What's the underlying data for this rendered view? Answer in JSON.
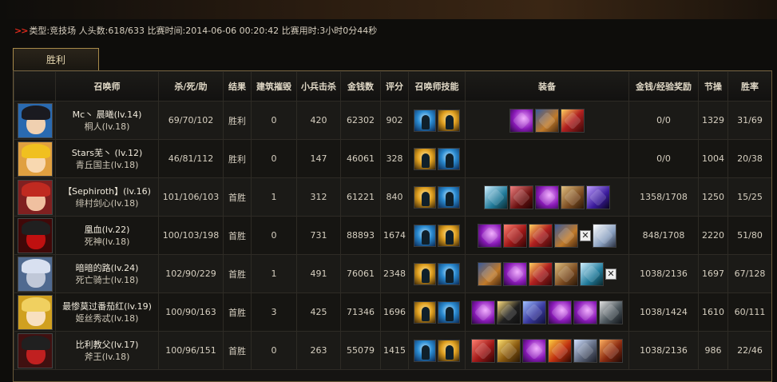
{
  "match_info": {
    "arrows": ">>",
    "text": "类型:竞技场 人头数:618/633 比赛时间:2014-06-06 00:20:42 比赛用时:3小时0分44秒"
  },
  "tab": {
    "label": "胜利"
  },
  "table": {
    "headers": {
      "avatar": "",
      "summoner": "召唤师",
      "kda": "杀/死/助",
      "result": "结果",
      "buildings": "建筑摧毁",
      "cs": "小兵击杀",
      "gold": "金钱数",
      "score": "评分",
      "skills": "召唤师技能",
      "items": "装备",
      "reward": "金钱/经验奖励",
      "integrity": "节操",
      "winrate": "胜率"
    },
    "rows": [
      {
        "avatar_icon": "kirito-avatar-icon",
        "name": "Mc丶 晨曦(lv.14)",
        "hero": "桐人(lv.18)",
        "kda": "69/70/102",
        "result": "胜利",
        "buildings": "0",
        "cs": "420",
        "gold": "62302",
        "score": "902",
        "skills": [
          "flash-icon",
          "teleport-icon"
        ],
        "items": [
          "purple-orb-item-icon",
          "armor-item-icon",
          "spear-item-icon"
        ],
        "reward": "0/0",
        "integrity": "1329",
        "winrate": "31/69"
      },
      {
        "avatar_icon": "naruto-avatar-icon",
        "name": "Stars芜丶 (lv.12)",
        "hero": "青丘国主(lv.18)",
        "kda": "46/81/112",
        "result": "胜利",
        "buildings": "0",
        "cs": "147",
        "gold": "46061",
        "score": "328",
        "skills": [
          "teleport-icon",
          "flash-icon"
        ],
        "items": [],
        "reward": "0/0",
        "integrity": "1004",
        "winrate": "20/38"
      },
      {
        "avatar_icon": "kenshin-avatar-icon",
        "name": "【Sephiroth】(lv.16)",
        "hero": "绯村剑心(lv.18)",
        "kda": "101/106/103",
        "result": "首胜",
        "buildings": "1",
        "cs": "312",
        "gold": "61221",
        "score": "840",
        "skills": [
          "teleport-icon",
          "flash-icon"
        ],
        "items": [
          "wolf-item-icon",
          "mask-item-icon",
          "purple-orb-item-icon",
          "axe-item-icon",
          "blade-item-icon"
        ],
        "reward": "1358/1708",
        "integrity": "1250",
        "winrate": "15/25"
      },
      {
        "avatar_icon": "reaper-avatar-icon",
        "name": "凰血(lv.22)",
        "hero": "死神(lv.18)",
        "kda": "100/103/198",
        "result": "首胜",
        "buildings": "0",
        "cs": "731",
        "gold": "88893",
        "score": "1674",
        "skills": [
          "flash-icon",
          "teleport-icon"
        ],
        "items": [
          "purple-orb-item-icon",
          "red-claw-item-icon",
          "spear-item-icon",
          "armor-item-icon",
          "empty-slot-icon",
          "wing-item-icon"
        ],
        "reward": "848/1708",
        "integrity": "2220",
        "winrate": "51/80"
      },
      {
        "avatar_icon": "death-knight-avatar-icon",
        "name": "暗暗的路(lv.24)",
        "hero": "死亡骑士(lv.18)",
        "kda": "102/90/229",
        "result": "首胜",
        "buildings": "1",
        "cs": "491",
        "gold": "76061",
        "score": "2348",
        "skills": [
          "teleport-icon",
          "flash-icon"
        ],
        "items": [
          "armor-item-icon",
          "purple-orb-item-icon",
          "spear-item-icon",
          "axe-item-icon",
          "wolf-item-icon",
          "empty-slot-icon"
        ],
        "reward": "1038/2136",
        "integrity": "1697",
        "winrate": "67/128"
      },
      {
        "avatar_icon": "blonde-avatar-icon",
        "name": "最惨莫过番茄红(lv.19)",
        "hero": "姬丝秀忒(lv.18)",
        "kda": "100/90/163",
        "result": "首胜",
        "buildings": "3",
        "cs": "425",
        "gold": "71346",
        "score": "1696",
        "skills": [
          "teleport-icon",
          "flash-icon"
        ],
        "items": [
          "purple-orb-item-icon",
          "sword-item-icon",
          "heart-item-icon",
          "purple-orb-item-icon",
          "purple-orb-item-icon",
          "dagger-item-icon"
        ],
        "reward": "1038/1424",
        "integrity": "1610",
        "winrate": "60/111"
      },
      {
        "avatar_icon": "axe-king-avatar-icon",
        "name": "比利教父(lv.17)",
        "hero": "斧王(lv.18)",
        "kda": "100/96/151",
        "result": "首胜",
        "buildings": "0",
        "cs": "263",
        "gold": "55079",
        "score": "1415",
        "skills": [
          "flash-icon",
          "teleport-icon"
        ],
        "items": [
          "red-claw-item-icon",
          "gold-item-icon",
          "purple-orb-item-icon",
          "fire-item-icon",
          "ring-item-icon",
          "claw-item-icon"
        ],
        "reward": "1038/2136",
        "integrity": "986",
        "winrate": "22/46"
      }
    ]
  },
  "empty_slot_glyph": "✕"
}
